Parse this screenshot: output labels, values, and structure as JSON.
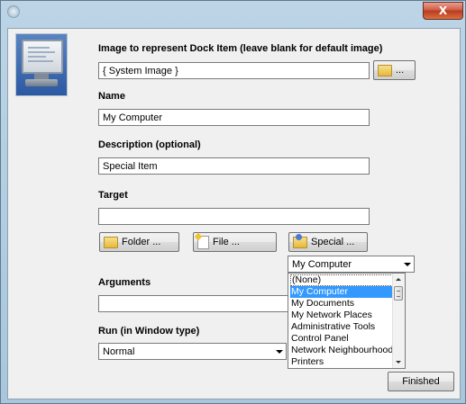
{
  "window": {
    "close_glyph": "X",
    "title_icon": "app-orb-icon"
  },
  "image": {
    "label": "Image to represent Dock Item (leave blank for default image)",
    "value": "{ System Image }",
    "browse_label": "...",
    "icon": "computer-monitor-icon"
  },
  "name": {
    "label": "Name",
    "value": "My Computer"
  },
  "description": {
    "label": "Description (optional)",
    "value": "Special Item"
  },
  "target": {
    "label": "Target",
    "value": "",
    "folder_label": "Folder ...",
    "file_label": "File ...",
    "special_label": "Special ..."
  },
  "special_dropdown": {
    "selected": "My Computer",
    "options": [
      "(None)",
      "My Computer",
      "My Documents",
      "My Network Places",
      "Administrative Tools",
      "Control Panel",
      "Network Neighbourhood",
      "Printers"
    ],
    "highlighted_index": 1
  },
  "arguments": {
    "label": "Arguments",
    "value": ""
  },
  "run": {
    "label": "Run (in  Window type)",
    "value": "Normal"
  },
  "finished_label": "Finished"
}
